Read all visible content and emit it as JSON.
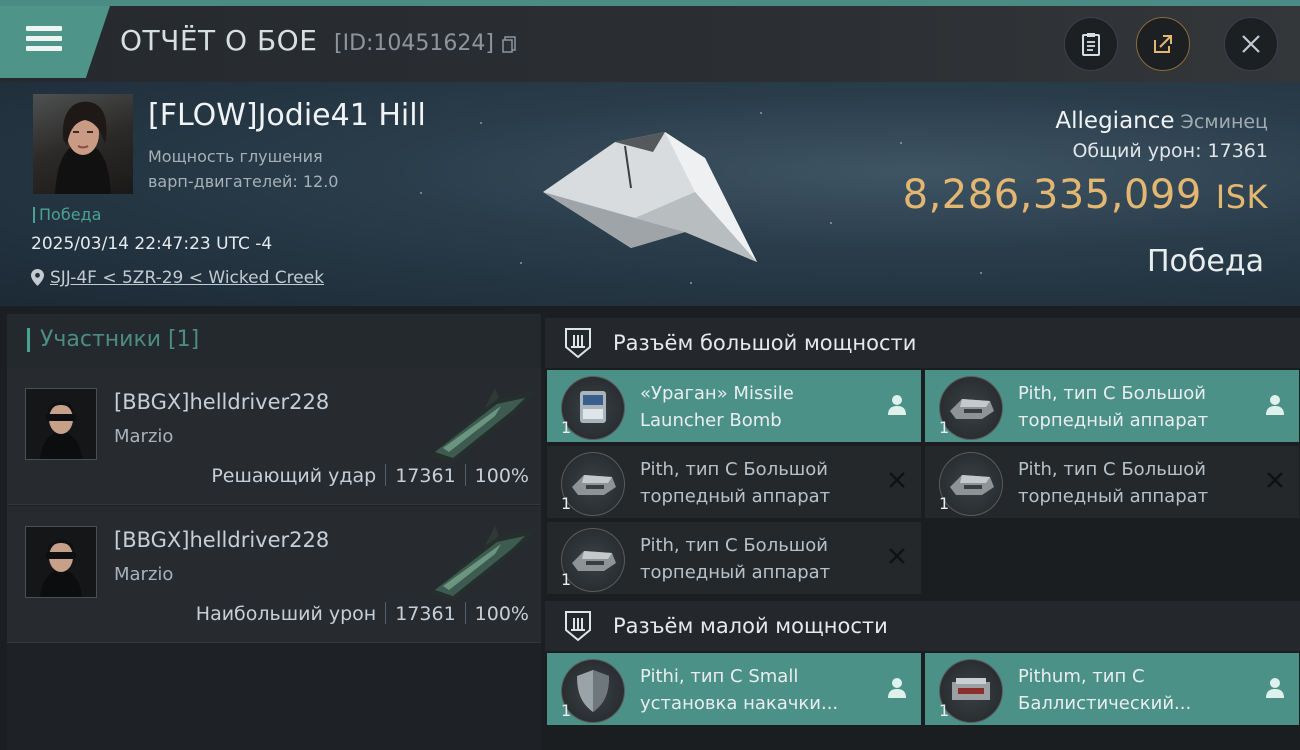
{
  "header": {
    "title": "ОТЧЁТ О БОЕ",
    "report_id": "[ID:10451624]"
  },
  "victim": {
    "name": "[FLOW]Jodie41 Hill",
    "info_line1": "Мощность глушения",
    "info_line2": "варп-двигателей: 12.0",
    "status_tag": "Победа",
    "datetime": "2025/03/14 22:47:23 UTC -4",
    "location": "SJJ-4F < 5ZR-29 < Wicked Creek",
    "ship_name": "Allegiance",
    "ship_class": "Эсминец",
    "damage_label": "Общий урон:",
    "damage_value": "17361",
    "isk_value": "8,286,335,099",
    "isk_currency": "ISK",
    "result": "Победа"
  },
  "participants": {
    "tab_label": "Участники [1]",
    "rows": [
      {
        "name": "[BBGX]helldriver228",
        "corp": "Marzio",
        "role": "Решающий удар",
        "damage": "17361",
        "percent": "100%"
      },
      {
        "name": "[BBGX]helldriver228",
        "corp": "Marzio",
        "role": "Наибольший урон",
        "damage": "17361",
        "percent": "100%"
      }
    ]
  },
  "fitting": {
    "high_title": "Разъём большой мощности",
    "low_title": "Разъём малой мощности",
    "high_slots": [
      {
        "name": "«Ураган» Missile Launcher Bomb",
        "qty": "1",
        "state": "dropped",
        "icon": "launcher-icon"
      },
      {
        "name": "Pith, тип C Большой торпедный аппарат",
        "qty": "1",
        "state": "dropped",
        "icon": "torpedo-launcher-icon"
      },
      {
        "name": "Pith, тип C Большой торпедный аппарат",
        "qty": "1",
        "state": "destroyed",
        "icon": "torpedo-launcher-icon"
      },
      {
        "name": "Pith, тип C Большой торпедный аппарат",
        "qty": "1",
        "state": "destroyed",
        "icon": "torpedo-launcher-icon"
      },
      {
        "name": "Pith, тип C Большой торпедный аппарат",
        "qty": "1",
        "state": "destroyed",
        "icon": "torpedo-launcher-icon"
      }
    ],
    "low_slots": [
      {
        "name": "Pithi, тип C Small установка накачки...",
        "qty": "1",
        "state": "dropped",
        "icon": "shield-booster-icon"
      },
      {
        "name": "Pithum, тип C Баллистический...",
        "qty": "1",
        "state": "dropped",
        "icon": "ballistic-control-icon"
      }
    ]
  },
  "colors": {
    "accent": "#4c9187",
    "isk": "#e3b772",
    "background": "#1b1e22"
  }
}
